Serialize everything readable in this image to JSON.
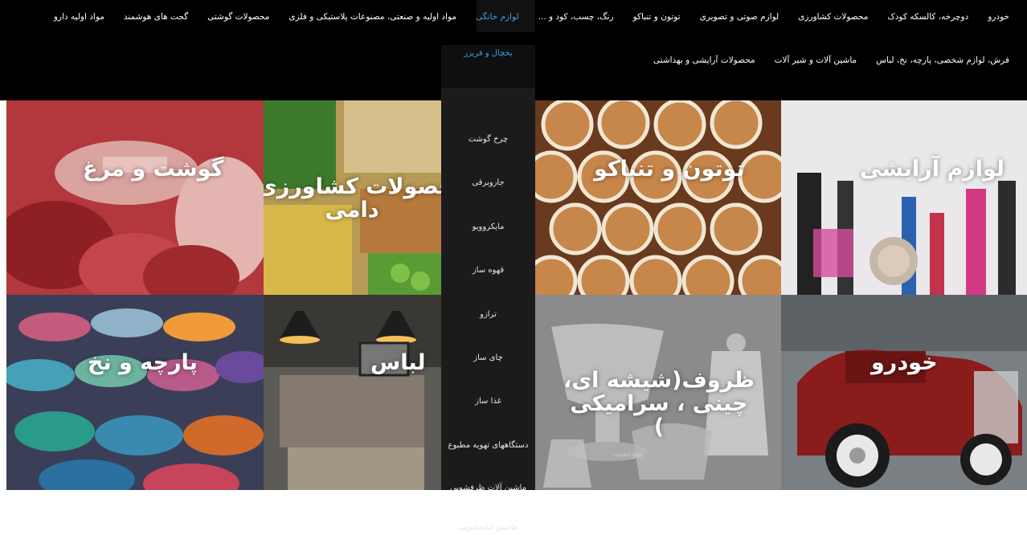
{
  "nav": {
    "row1": [
      "خودرو",
      "دوچرخه، کالسکه کودک",
      "محصولات کشاورزی",
      "لوازم صوتی و تصویری",
      "توتون و تنباکو",
      "رنگ، چسب، کود و ...",
      "لوازم خانگی",
      "مواد اولیه و صنعتی، مصنوعات پلاستیکی و فلزی",
      "محصولات گوشتی",
      "گجت های هوشمند",
      "مواد اولیه دارو"
    ],
    "row2": [
      "فرش، لوازم شخصی، پارچه، نخ، لباس",
      "ماشین آلات و شیر آلات",
      "محصولات آرایشی و بهداشتی"
    ],
    "active_index": 6
  },
  "dropdown": {
    "items": [
      "یخچال و فریزر",
      "چرخ گوشت",
      "جاروبرقی",
      "مایکروویو",
      "قهوه ساز",
      "ترازو",
      "چای ساز",
      "غذا ساز",
      "دستگاههای تهویه مطبوع",
      "ماشین آلات ظرفشویی",
      "ماشین لباسشویی"
    ]
  },
  "tiles": [
    {
      "label": "گوشت و مرغ",
      "name": "tile-meat"
    },
    {
      "label": "محصولات کشاورزی و دامی",
      "name": "tile-agriculture"
    },
    {
      "label": "توتون و تنباکو",
      "name": "tile-tobacco"
    },
    {
      "label": "لوازم آرایشی",
      "name": "tile-cosmetics"
    },
    {
      "label": "پارچه و نخ",
      "name": "tile-fabric"
    },
    {
      "label": "لباس",
      "name": "tile-clothing"
    },
    {
      "label": "ظروف(شیشه ای، چینی ، سرامیکی )",
      "name": "tile-dishes"
    },
    {
      "label": "خودرو",
      "name": "tile-car"
    }
  ],
  "watermark": "پیوست",
  "colors": {
    "nav_bg": "#000000",
    "accent": "#3aa0e6",
    "dropdown_bg": "#1b1b1b"
  }
}
